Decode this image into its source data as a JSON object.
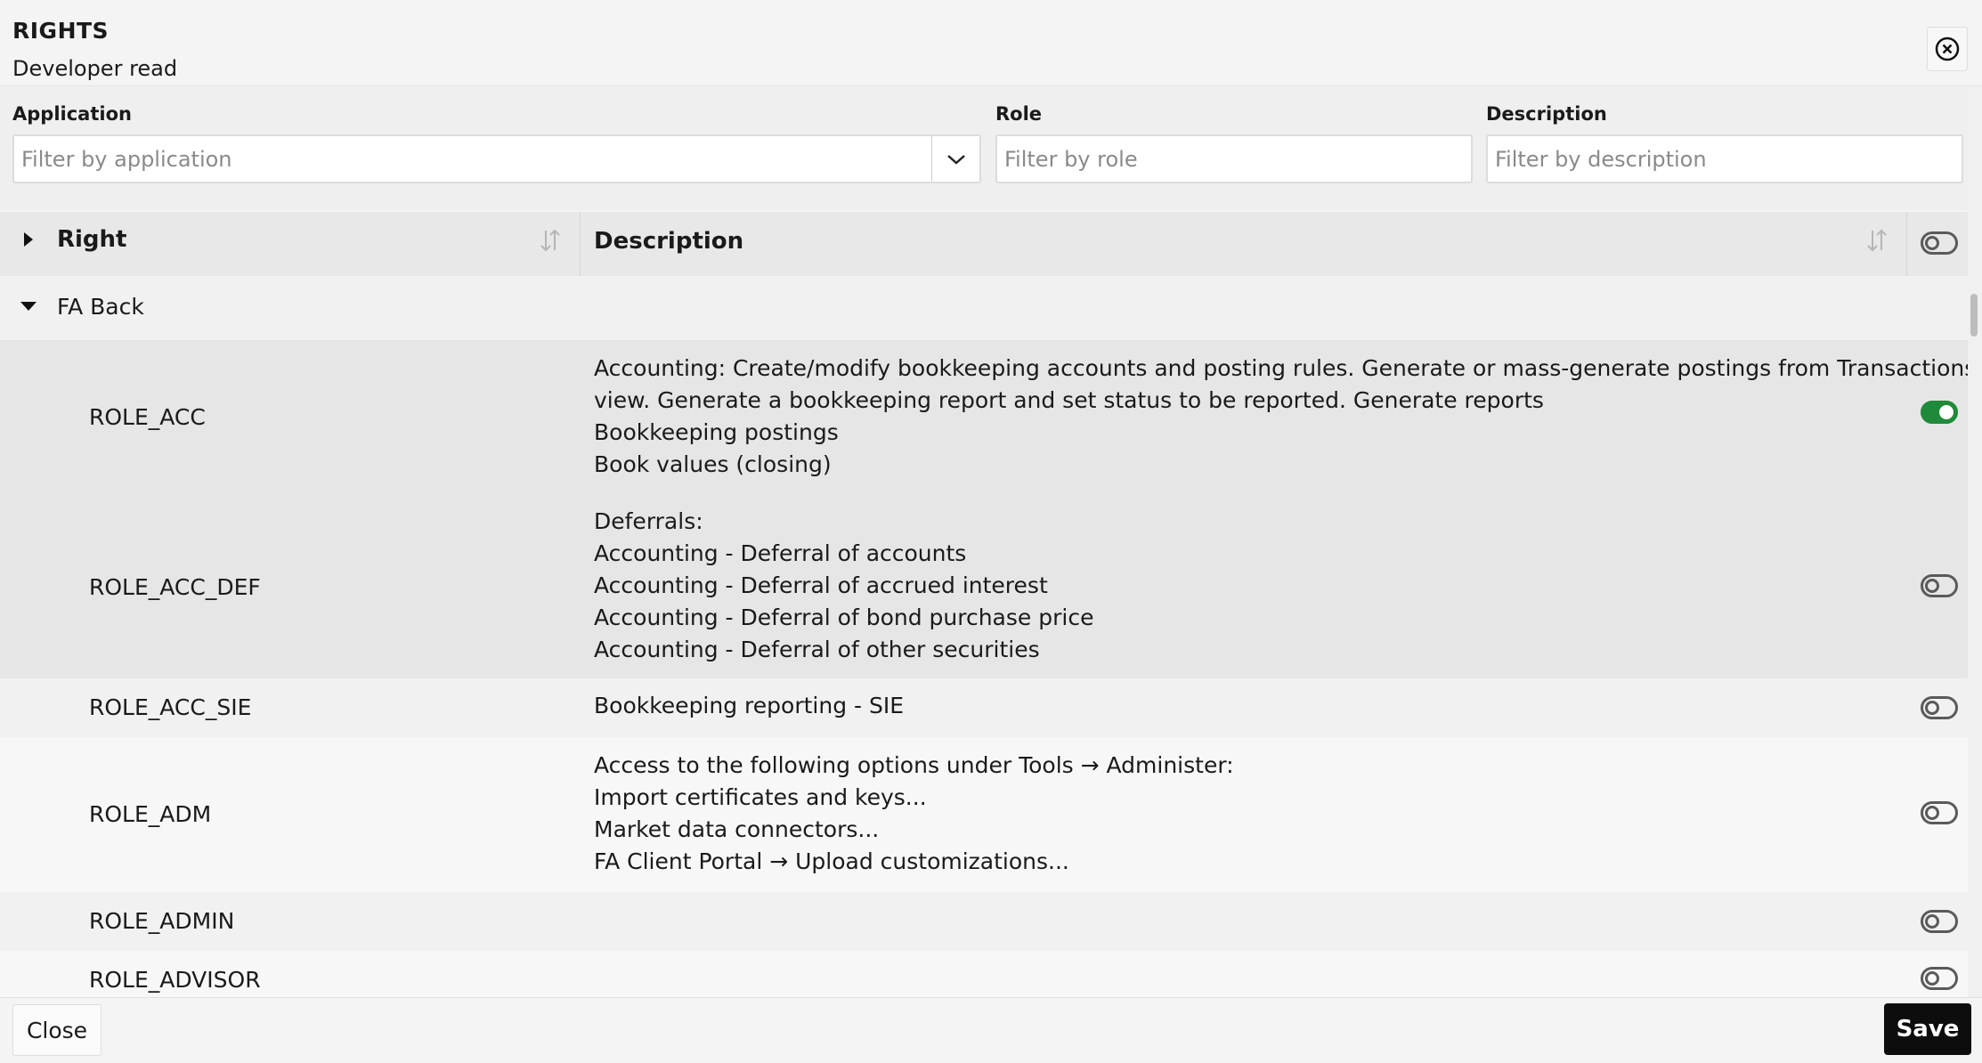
{
  "header": {
    "title": "RIGHTS",
    "subtitle": "Developer read"
  },
  "filters": {
    "application": {
      "label": "Application",
      "placeholder": "Filter by application"
    },
    "role": {
      "label": "Role",
      "placeholder": "Filter by role"
    },
    "description": {
      "label": "Description",
      "placeholder": "Filter by description"
    }
  },
  "table": {
    "columns": {
      "right": "Right",
      "description": "Description"
    },
    "group": {
      "label": "FA Back"
    },
    "rows": [
      {
        "name": "ROLE_ACC",
        "desc": [
          "Accounting: Create/modify bookkeeping accounts and posting rules. Generate or mass-generate postings from Transactions",
          "view. Generate a bookkeeping report and set status to be reported. Generate reports",
          "Bookkeeping postings",
          "Book values (closing)"
        ],
        "enabled": true
      },
      {
        "name": "ROLE_ACC_DEF",
        "desc": [
          "Deferrals:",
          "Accounting - Deferral of accounts",
          "Accounting - Deferral of accrued interest",
          "Accounting - Deferral of bond purchase price",
          "Accounting - Deferral of other securities"
        ],
        "enabled": false
      },
      {
        "name": "ROLE_ACC_SIE",
        "desc": [
          "Bookkeeping reporting - SIE"
        ],
        "enabled": false
      },
      {
        "name": "ROLE_ADM",
        "desc": [
          "Access to the following options under Tools → Administer:",
          "Import certificates and keys...",
          "Market data connectors...",
          "FA Client Portal → Upload customizations..."
        ],
        "enabled": false
      },
      {
        "name": "ROLE_ADMIN",
        "desc": [],
        "enabled": false
      },
      {
        "name": "ROLE_ADVISOR",
        "desc": [],
        "enabled": false
      }
    ]
  },
  "footer": {
    "close_label": "Close",
    "save_label": "Save"
  },
  "colors": {
    "toggle_on": "#1f8a3a",
    "save_bg": "#0d0d0d"
  }
}
